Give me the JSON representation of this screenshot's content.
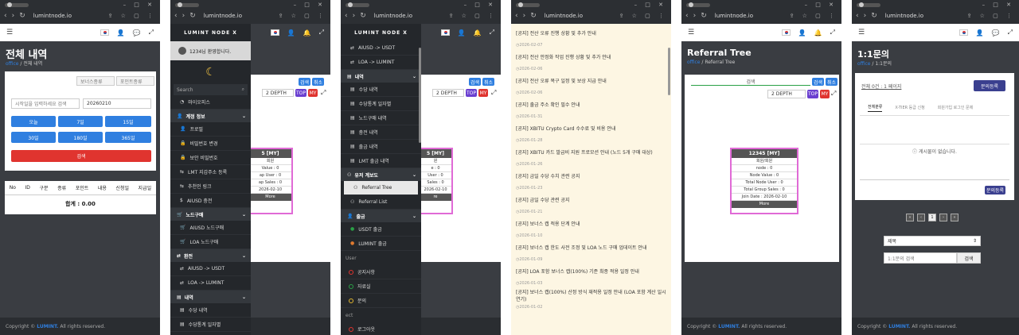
{
  "browser": {
    "url": "lumintnode.io"
  },
  "footer": {
    "prefix": "Copyright ©",
    "brand": "LUMINT.",
    "suffix": "All rights reserved."
  },
  "colors": {
    "accent": "#2f7fe0",
    "danger": "#e0342f",
    "sidebar": "#24272b",
    "notice_bg": "#fdf6e3"
  },
  "p1": {
    "title": "전체 내역",
    "crumb_home": "office",
    "crumb_cur": "전체 내역",
    "select1": "보너스종류",
    "select2": "포인트종류",
    "search_placeholder": "시작일을 입력하세요 검색",
    "date_value": "20260210",
    "ranges": [
      "오늘",
      "7일",
      "15일",
      "30일",
      "180일",
      "365일"
    ],
    "search_btn": "검색",
    "columns": [
      "No",
      "ID",
      "구분",
      "종류",
      "포인트",
      "내용",
      "신청일",
      "지급일"
    ],
    "total": "합계 : 0.00"
  },
  "p2": {
    "logo": "LUMINT NODE X",
    "greeting": "1234님 환영합니다.",
    "search_placeholder": "Search",
    "items": [
      {
        "kind": "item",
        "icon": "◔",
        "label": "마이오피스"
      },
      {
        "kind": "head",
        "icon": "👤",
        "label": "계정 정보"
      },
      {
        "kind": "item",
        "icon": "👤",
        "label": "프로필"
      },
      {
        "kind": "item",
        "icon": "🔒",
        "label": "비밀번호 변경"
      },
      {
        "kind": "item",
        "icon": "🔒",
        "label": "보안 비밀번호"
      },
      {
        "kind": "item",
        "icon": "⇆",
        "label": "LMT 지갑주소 등록"
      },
      {
        "kind": "item",
        "icon": "⇆",
        "label": "추천인 링크"
      },
      {
        "kind": "item",
        "icon": "$",
        "label": "AIUSD 충전"
      },
      {
        "kind": "head",
        "icon": "🛒",
        "label": "노드구매"
      },
      {
        "kind": "item",
        "icon": "🛒",
        "label": "AIUSD 노드구매"
      },
      {
        "kind": "item",
        "icon": "🛒",
        "label": "LOA 노드구매"
      },
      {
        "kind": "head",
        "icon": "⇄",
        "label": "환전"
      },
      {
        "kind": "item",
        "icon": "⇄",
        "label": "AIUSD -> USDT"
      },
      {
        "kind": "item",
        "icon": "⇄",
        "label": "LOA -> LUMINT"
      },
      {
        "kind": "head",
        "icon": "▤",
        "label": "내역"
      },
      {
        "kind": "item",
        "icon": "▤",
        "label": "수당 내역"
      },
      {
        "kind": "item",
        "icon": "▤",
        "label": "수당통계 일자별"
      }
    ],
    "bg_buttons": [
      "검색",
      "취소"
    ],
    "bg_depth": "2 DEPTH",
    "bg_top": "TOP",
    "bg_my": "MY",
    "bg_tree": [
      "5 [MY]",
      "회원",
      "Value : 0",
      "ap User : 0",
      "ap Sales : 0",
      "2026-02-10",
      "More"
    ]
  },
  "p3": {
    "logo": "LUMINT NODE X",
    "items": [
      {
        "kind": "item",
        "icon": "⇄",
        "label": "AIUSD -> USDT"
      },
      {
        "kind": "item",
        "icon": "⇄",
        "label": "LOA -> LUMINT"
      },
      {
        "kind": "head",
        "icon": "▤",
        "label": "내역"
      },
      {
        "kind": "item",
        "icon": "▤",
        "label": "수당 내역"
      },
      {
        "kind": "item",
        "icon": "▤",
        "label": "수당통계 일자별"
      },
      {
        "kind": "item",
        "icon": "▤",
        "label": "노드구매 내역"
      },
      {
        "kind": "item",
        "icon": "▤",
        "label": "충전 내역"
      },
      {
        "kind": "item",
        "icon": "▤",
        "label": "출금 내역"
      },
      {
        "kind": "item",
        "icon": "▤",
        "label": "LMT 출금 내역"
      },
      {
        "kind": "head",
        "icon": "⚇",
        "label": "유저 계보도"
      },
      {
        "kind": "active",
        "icon": "⚇",
        "label": "Referral Tree"
      },
      {
        "kind": "item",
        "icon": "⚇",
        "label": "Referral List"
      },
      {
        "kind": "head",
        "icon": "👤",
        "label": "출금"
      },
      {
        "kind": "item",
        "icon": "●",
        "label": "USDT 출금"
      },
      {
        "kind": "item",
        "icon": "●",
        "label": "LUMINT 출금"
      },
      {
        "kind": "sec",
        "icon": "",
        "label": "User"
      },
      {
        "kind": "ring",
        "icon": "red",
        "label": "공지사항"
      },
      {
        "kind": "ring",
        "icon": "green",
        "label": "자료실"
      },
      {
        "kind": "ring",
        "icon": "yellow",
        "label": "문의"
      },
      {
        "kind": "sec",
        "icon": "",
        "label": "ect"
      },
      {
        "kind": "ring",
        "icon": "red",
        "label": "로그아웃"
      }
    ],
    "bg_buttons": [
      "검색",
      "취소"
    ],
    "bg_depth": "2 DEPTH",
    "bg_top": "TOP",
    "bg_my": "MY",
    "bg_tree": [
      "5 [MY]",
      "원",
      "e : 0",
      "User : 0",
      "Sales : 0",
      "2026-02-10",
      "re"
    ]
  },
  "p4": {
    "notices": [
      {
        "title": "[공지] 전산 오류 진행 상황 및 추가 안내",
        "date": "2026-02-07"
      },
      {
        "title": "[공지] 전산 안정화 작업 진행 상황 및 추가 안내",
        "date": "2026-02-06"
      },
      {
        "title": "[공지] 전산 오류 복구 일정 및 보상 지급 안내",
        "date": "2026-02-06"
      },
      {
        "title": "[공지] 출금 주소 확인 필수 안내",
        "date": "2026-01-31"
      },
      {
        "title": "[공지] XBITU Crypto Card 수수료 및 비용 안내",
        "date": "2026-01-28"
      },
      {
        "title": "[공지] XBITU 카드 발급비 지원 프로모션 안내 (노드 5개 구매 대상)",
        "date": "2026-01-26"
      },
      {
        "title": "[공지] 금일 수당 수치 관련 공지",
        "date": "2026-01-23"
      },
      {
        "title": "[공지] 금일 수당 관련 공지",
        "date": "2026-01-21"
      },
      {
        "title": "[공지] 보너스 캡 적용 단계 안내",
        "date": "2026-01-10"
      },
      {
        "title": "[공지] 보너스 캡 한도 사전 조정 및 LOA 노드 구매 업데이트 안내",
        "date": "2026-01-09"
      },
      {
        "title": "[공지] LOA 포함 보너스 캡(100%) 기준 최종 적용 일정 안내",
        "date": "2026-01-03"
      },
      {
        "title": "[공지] 보너스 캡(100%) 산정 방식 재적용 일정 안내 (LOA 포함 계산 일시 연기)",
        "date": "2026-01-02"
      }
    ]
  },
  "p5": {
    "title": "Referral Tree",
    "crumb_home": "office",
    "crumb_cur": "Referral Tree",
    "search_label": "검색",
    "buttons": [
      "검색",
      "취소"
    ],
    "depth": "2 DEPTH",
    "top": "TOP",
    "my": "MY",
    "node": {
      "header": "12345 [MY]",
      "rows": [
        "회원/회원",
        "node : 0",
        "Node Value : 0",
        "Total Node User : 0",
        "Total Group Sales : 0",
        "Join Date : 2026-02-10"
      ],
      "more": "More"
    }
  },
  "p6": {
    "title": "1:1문의",
    "crumb_home": "office",
    "crumb_cur": "1:1문의",
    "summary": "전체 0건 : 1 페이지",
    "register_btn": "문의등록",
    "tabs": [
      "전체분류",
      "X-TIER 등급 신청",
      "회원가입 로그인 문제"
    ],
    "empty": "게시물이 없습니다.",
    "register_btn2": "문의등록",
    "pages": [
      "«",
      "‹",
      "1",
      "›",
      "»"
    ],
    "select": "제목",
    "search_placeholder": "1:1문의 검색",
    "search_btn": "검색"
  }
}
